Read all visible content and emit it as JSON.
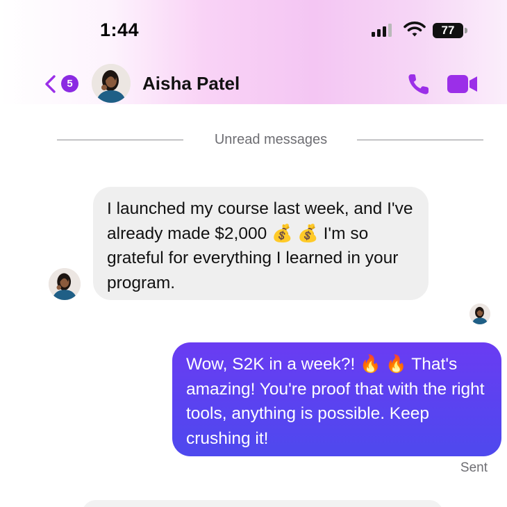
{
  "status_bar": {
    "time": "1:44",
    "battery": "77",
    "signal_icon": "cellular-signal-icon",
    "wifi_icon": "wifi-icon"
  },
  "header": {
    "back_badge_count": "5",
    "contact_name": "Aisha Patel",
    "call_icon": "phone-icon",
    "video_icon": "video-camera-icon",
    "accent_color": "#9b2fe8"
  },
  "divider": {
    "label": "Unread messages"
  },
  "messages": [
    {
      "direction": "incoming",
      "text": "I launched my course last week, and I've already made $2,000 💰 💰 I'm so grateful for everything I learned in your program."
    },
    {
      "direction": "outgoing",
      "text": "Wow, S2K in a week?! 🔥 🔥 That's amazing! You're proof that with the right tools, anything is possible. Keep crushing it!",
      "status": "Sent"
    }
  ],
  "colors": {
    "incoming_bubble": "#efefef",
    "outgoing_bubble": "#5a43f0"
  }
}
